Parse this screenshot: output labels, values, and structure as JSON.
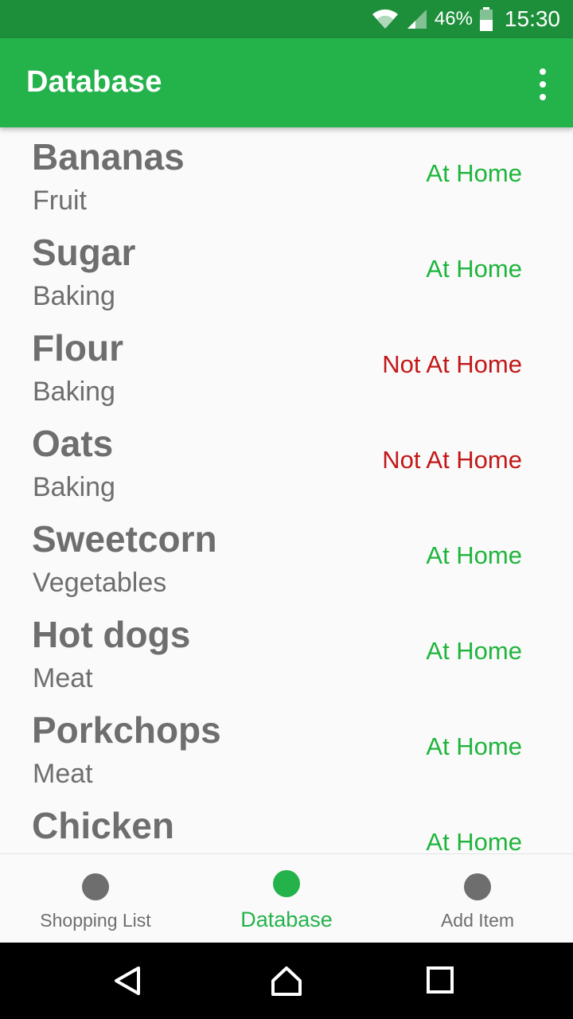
{
  "status_bar": {
    "battery": "46%",
    "time": "15:30"
  },
  "app_bar": {
    "title": "Database"
  },
  "items": [
    {
      "name": "Bananas",
      "category": "Fruit",
      "status": "At Home",
      "status_color": "#1fb53c"
    },
    {
      "name": "Sugar",
      "category": "Baking",
      "status": "At Home",
      "status_color": "#1fb53c"
    },
    {
      "name": "Flour",
      "category": "Baking",
      "status": "Not At Home",
      "status_color": "#c21818"
    },
    {
      "name": "Oats",
      "category": "Baking",
      "status": "Not At Home",
      "status_color": "#c21818"
    },
    {
      "name": "Sweetcorn",
      "category": "Vegetables",
      "status": "At Home",
      "status_color": "#1fb53c"
    },
    {
      "name": "Hot dogs",
      "category": "Meat",
      "status": "At Home",
      "status_color": "#1fb53c"
    },
    {
      "name": "Porkchops",
      "category": "Meat",
      "status": "At Home",
      "status_color": "#1fb53c"
    },
    {
      "name": "Chicken",
      "category": "",
      "status": "At Home",
      "status_color": "#1fb53c"
    }
  ],
  "bottom_nav": [
    {
      "label": "Shopping List",
      "active": false
    },
    {
      "label": "Database",
      "active": true
    },
    {
      "label": "Add Item",
      "active": false
    }
  ],
  "colors": {
    "status_bar": "#1d8f3b",
    "app_bar": "#24b24b",
    "accent": "#24b24b",
    "at_home": "#1fb53c",
    "not_at_home": "#c21818"
  }
}
